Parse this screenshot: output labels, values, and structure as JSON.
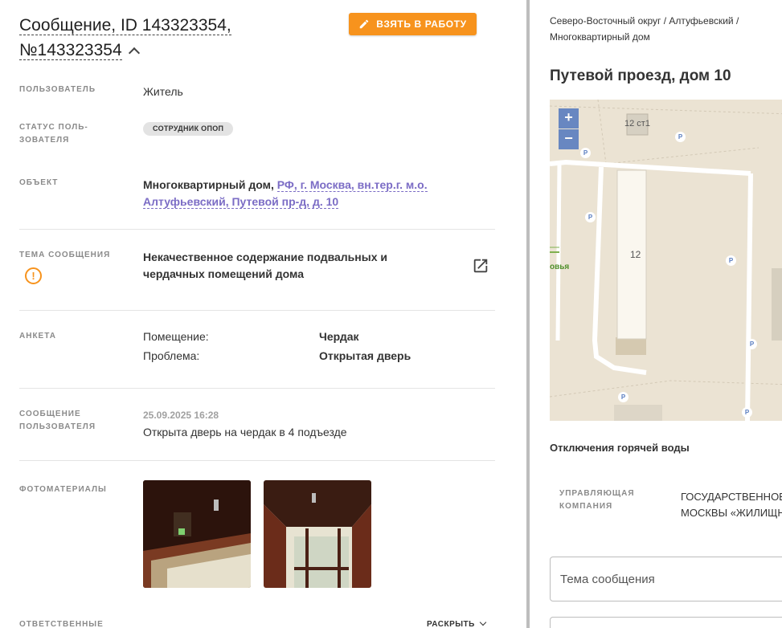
{
  "header": {
    "title": "Сообщение, ID 143323354, №143323354",
    "take_button": "ВЗЯТЬ В РАБОТУ"
  },
  "fields": {
    "user_label": "ПОЛЬЗОВАТЕЛЬ",
    "user_value": "Житель",
    "user_status_label": "СТАТУС ПОЛЬ-ЗОВАТЕЛЯ",
    "user_status_badge": "СОТРУДНИК ОПОП",
    "object_label": "ОБЪЕКТ",
    "object_type": "Многоквартирный дом,",
    "object_address": "РФ, г. Москва, вн.тер.г. м.о. Алтуфьевский, Путевой пр-д, д. 10",
    "topic_label": "ТЕМА СООБЩЕНИЯ",
    "topic_value": "Некачественное содержание подвальных и чердачных помещений дома",
    "form_label": "АНКЕТА",
    "form_rows": [
      {
        "key": "Помещение:",
        "value": "Чердак"
      },
      {
        "key": "Проблема:",
        "value": "Открытая дверь"
      }
    ],
    "user_message_label": "СООБЩЕНИЕ ПОЛЬЗОВАТЕЛЯ",
    "message_date": "25.09.2025 16:28",
    "message_text": "Открыта дверь на чердак в 4 подъезде",
    "photos_label": "ФОТОМАТЕРИАЛЫ",
    "responsible_label": "ОТВЕТСТВЕННЫЕ",
    "expand_label": "РАСКРЫТЬ"
  },
  "right_panel": {
    "breadcrumb_line1": "Северо-Восточный округ / Алтуфьевский /",
    "breadcrumb_line2": "Многоквартирный дом",
    "address_title": "Путевой проезд, дом 10",
    "map": {
      "label_building_12ct1": "12 ст1",
      "label_building_12": "12",
      "label_street": "овья",
      "zoom_in": "+",
      "zoom_out": "−",
      "parking_marker": "P"
    },
    "hot_water_title": "Отключения горячей воды",
    "mgmt_company_label_1": "УПРАВЛЯЮЩАЯ",
    "mgmt_company_label_2": "КОМПАНИЯ",
    "mgmt_company_value_1": "ГОСУДАРСТВЕННОЕ",
    "mgmt_company_value_2": "МОСКВЫ «ЖИЛИЩНИК",
    "topic_input_placeholder": "Тема сообщения"
  },
  "colors": {
    "accent_orange": "#f7931d",
    "link_purple": "#7b6cc5",
    "badge_grey": "#e3e3e3"
  },
  "icons": {
    "take_button_icon": "pencil-icon",
    "title_toggle_icon": "chevron-up-icon",
    "topic_warning_icon": "warning-circle-icon",
    "topic_open_icon": "open-in-new-icon",
    "expand_icon": "chevron-down-icon"
  }
}
